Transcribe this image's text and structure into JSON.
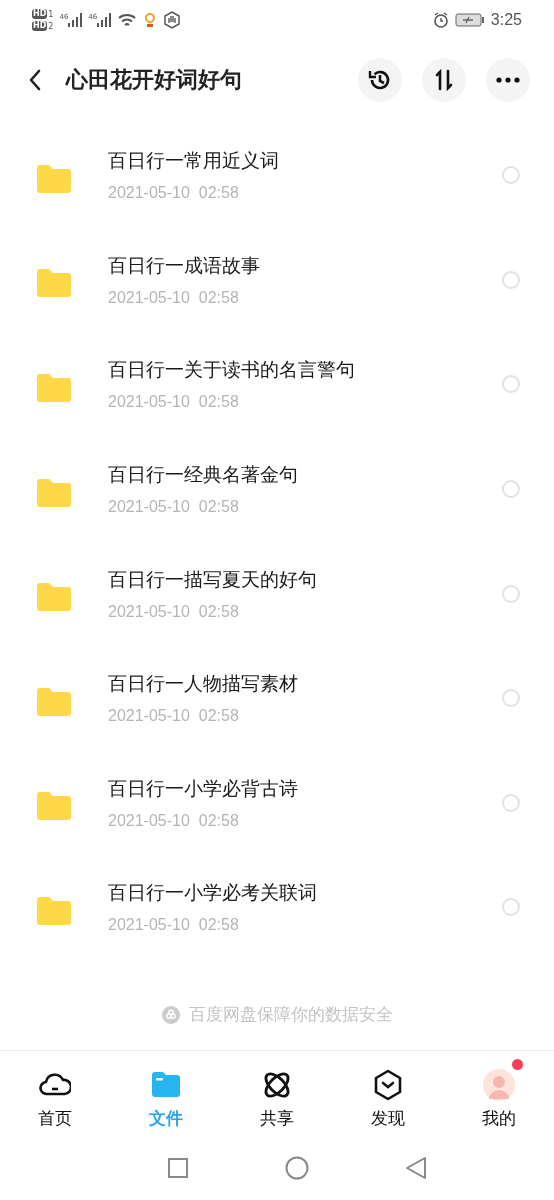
{
  "status_bar": {
    "sims": [
      {
        "label": "HD",
        "slot": "1"
      },
      {
        "label": "HD",
        "slot": "2"
      }
    ],
    "networks": [
      "46",
      "46"
    ],
    "time": "3:25"
  },
  "header": {
    "title": "心田花开好词好句"
  },
  "files": [
    {
      "name": "百日行一常用近义词",
      "date": "2021-05-10  02:58",
      "selected": false
    },
    {
      "name": "百日行一成语故事",
      "date": "2021-05-10  02:58",
      "selected": false
    },
    {
      "name": "百日行一关于读书的名言警句",
      "date": "2021-05-10  02:58",
      "selected": false
    },
    {
      "name": "百日行一经典名著金句",
      "date": "2021-05-10  02:58",
      "selected": false
    },
    {
      "name": "百日行一描写夏天的好句",
      "date": "2021-05-10  02:58",
      "selected": false
    },
    {
      "name": "百日行一人物描写素材",
      "date": "2021-05-10  02:58",
      "selected": false
    },
    {
      "name": "百日行一小学必背古诗",
      "date": "2021-05-10  02:58",
      "selected": false
    },
    {
      "name": "百日行一小学必考关联词",
      "date": "2021-05-10  02:58",
      "selected": false
    }
  ],
  "footer_note": "百度网盘保障你的数据安全",
  "tabs": [
    {
      "label": "首页",
      "kind": "home",
      "selected": false,
      "badge": false
    },
    {
      "label": "文件",
      "kind": "files",
      "selected": true,
      "badge": false
    },
    {
      "label": "共享",
      "kind": "share",
      "selected": false,
      "badge": false
    },
    {
      "label": "发现",
      "kind": "discover",
      "selected": false,
      "badge": false
    },
    {
      "label": "我的",
      "kind": "me",
      "selected": false,
      "badge": true
    }
  ]
}
